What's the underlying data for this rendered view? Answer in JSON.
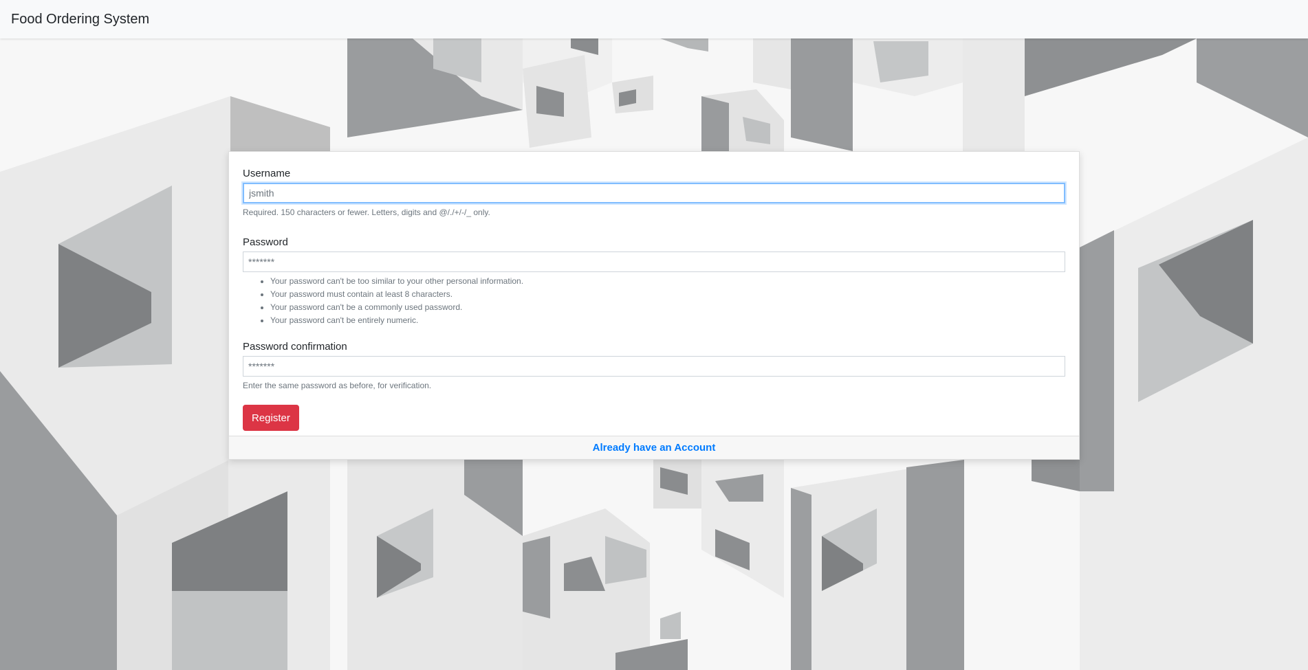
{
  "navbar": {
    "brand": "Food Ordering System"
  },
  "form": {
    "username": {
      "label": "Username",
      "placeholder": "jsmith",
      "help": "Required. 150 characters or fewer. Letters, digits and @/./+/-/_ only."
    },
    "password": {
      "label": "Password",
      "placeholder": "*******",
      "help_items": [
        "Your password can't be too similar to your other personal information.",
        "Your password must contain at least 8 characters.",
        "Your password can't be a commonly used password.",
        "Your password can't be entirely numeric."
      ]
    },
    "password_confirmation": {
      "label": "Password confirmation",
      "placeholder": "*******",
      "help": "Enter the same password as before, for verification."
    },
    "submit_label": "Register"
  },
  "footer": {
    "login_link": "Already have an Account"
  },
  "colors": {
    "register_button": "#dc3545",
    "link": "#007bff",
    "focus_border": "#80bdff",
    "navbar_bg": "#f8f9fa"
  }
}
